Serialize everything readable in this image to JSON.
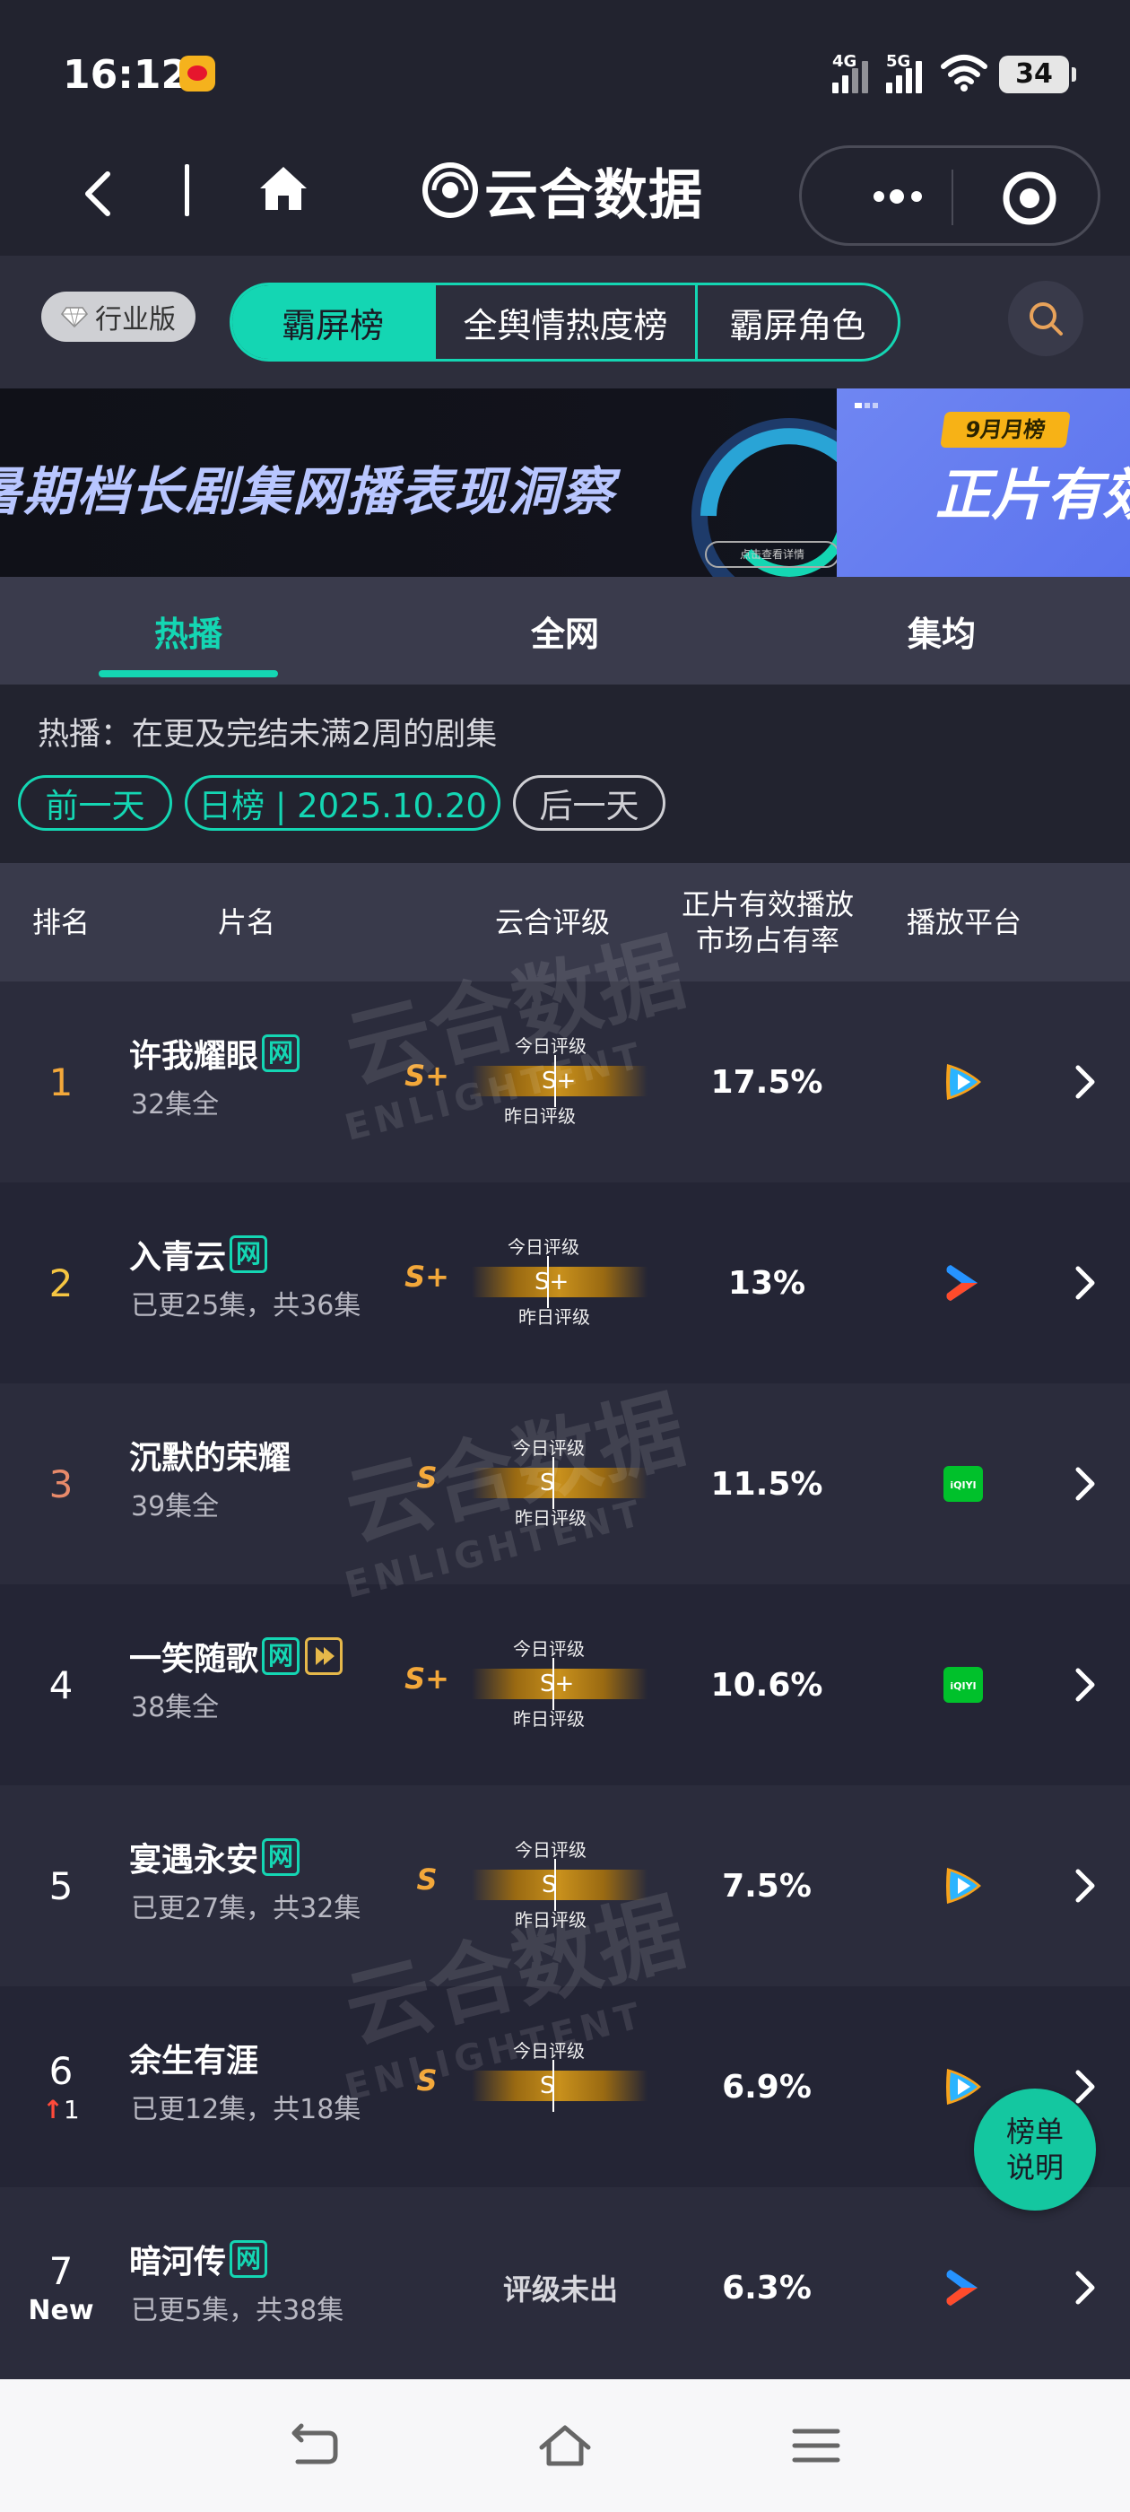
{
  "status_bar": {
    "time": "16:12",
    "sig1_label": "4G",
    "sig2_label": "5G",
    "battery": "34"
  },
  "nav": {
    "logo_text": "云合数据"
  },
  "filters": {
    "version_label": "行业版",
    "segments": [
      "霸屏榜",
      "全舆情热度榜",
      "霸屏角色"
    ]
  },
  "banner": {
    "headline": "暑期档长剧集网播表现洞察",
    "button_text": "点击查看详情",
    "tag": "9月月榜",
    "big_text": "正片有效"
  },
  "tabs": [
    "热播",
    "全网",
    "集均"
  ],
  "description": "热播：在更及完结未满2周的剧集",
  "date_controls": {
    "prev": "前一天",
    "current": "日榜 | 2025.10.20",
    "next": "后一天"
  },
  "table_header": {
    "rank": "排名",
    "title": "片名",
    "rating": "云合评级",
    "share_line1": "正片有效播放",
    "share_line2": "市场占有率",
    "platform": "播放平台"
  },
  "rating_labels": {
    "today": "今日评级",
    "yesterday": "昨日评级",
    "pending": "评级未出"
  },
  "rows": [
    {
      "rank": "1",
      "title": "许我耀眼",
      "badge": "网",
      "episodes": "32集全",
      "grade": "S+",
      "today": "S+",
      "share": "17.5%",
      "platform": "tencent"
    },
    {
      "rank": "2",
      "title": "入青云",
      "badge": "网",
      "episodes": "已更25集，共36集",
      "grade": "S+",
      "today": "S+",
      "share": "13%",
      "platform": "youku"
    },
    {
      "rank": "3",
      "title": "沉默的荣耀",
      "badge": "",
      "episodes": "39集全",
      "grade": "S",
      "today": "S",
      "share": "11.5%",
      "platform": "iqiyi"
    },
    {
      "rank": "4",
      "title": "一笑随歌",
      "badge": "网",
      "episodes": "38集全",
      "grade": "S+",
      "today": "S+",
      "share": "10.6%",
      "platform": "iqiyi"
    },
    {
      "rank": "5",
      "title": "宴遇永安",
      "badge": "网",
      "episodes": "已更27集，共32集",
      "grade": "S",
      "today": "S",
      "share": "7.5%",
      "platform": "tencent"
    },
    {
      "rank": "6",
      "rank_change": "1",
      "title": "余生有涯",
      "badge": "",
      "episodes": "已更12集，共18集",
      "grade": "S",
      "today": "S",
      "share": "6.9%",
      "platform": "tencent"
    },
    {
      "rank": "7",
      "rank_new": "New",
      "title": "暗河传",
      "badge": "网",
      "episodes": "已更5集，共38集",
      "share": "6.3%",
      "platform": "youku"
    }
  ],
  "iqiyi_label": "iQIYI",
  "watermark": {
    "text": "云合数据",
    "sub": "ENLIGHTENT"
  },
  "fab": {
    "line1": "榜单",
    "line2": "说明"
  },
  "colors": {
    "accent": "#14d6b3",
    "rank1": "#f3a83a",
    "rank2": "#f5c542",
    "rank3": "#e88a6a",
    "grade": "#f3a83a",
    "up_arrow": "#ff4a3a"
  }
}
